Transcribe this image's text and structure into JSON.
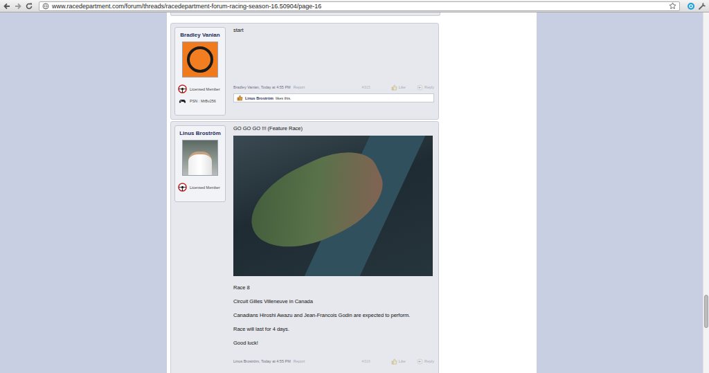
{
  "browser": {
    "url": "www.racedepartment.com/forum/threads/racedepartment-forum-racing-season-16.50904/page-16"
  },
  "posts": [
    {
      "author": "Bradley Vanian",
      "avatar_kind": "logo",
      "badges": [
        {
          "kind": "licensed",
          "label": "Licensed Member"
        },
        {
          "kind": "psn",
          "label": "PSN : MrBv256"
        }
      ],
      "blocks": [
        {
          "kind": "text",
          "text": "start"
        }
      ],
      "byline": "Bradley Vanian, Today at 4:55 PM",
      "report": "Report",
      "number": "#315",
      "like": "Like",
      "reply": "Reply",
      "likes": {
        "name": "Linus Broström",
        "text": "likes this."
      }
    },
    {
      "author": "Linus Broström",
      "avatar_kind": "photo",
      "badges": [
        {
          "kind": "licensed",
          "label": "Licensed Member"
        }
      ],
      "blocks": [
        {
          "kind": "text",
          "text": "GO GO GO !!! (Feature Race)"
        },
        {
          "kind": "image"
        },
        {
          "kind": "text",
          "text": "Race 8"
        },
        {
          "kind": "text",
          "text": "Circuit Gilles Villeneuve in Canada"
        },
        {
          "kind": "text",
          "text": "Canadians Hiroshi Awazu and Jean-Francois Godin are expected to perform."
        },
        {
          "kind": "text",
          "text": "Race will last for 4 days."
        },
        {
          "kind": "text",
          "text": "Good luck!"
        }
      ],
      "byline": "Linus Broström, Today at 4:55 PM",
      "report": "Report",
      "number": "#316",
      "like": "Like",
      "reply": "Reply"
    }
  ]
}
